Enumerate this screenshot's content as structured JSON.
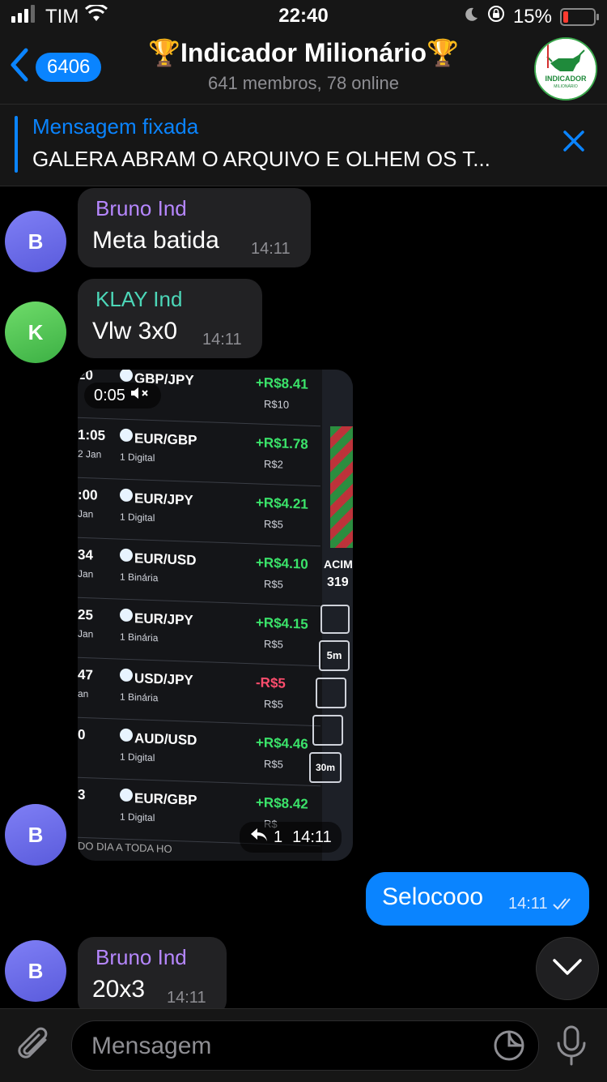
{
  "status_bar": {
    "carrier": "TIM",
    "time": "22:40",
    "battery": "15%"
  },
  "header": {
    "back_count": "6406",
    "title": "🏆Indicador Milionário🏆",
    "subtitle": "641 membros, 78 online",
    "avatar_logo_text": "INDICADOR MILIONÁRIO"
  },
  "pinned": {
    "title": "Mensagem fixada",
    "text": "GALERA ABRAM O ARQUIVO E OLHEM OS T..."
  },
  "messages": [
    {
      "sender": "Bruno Ind",
      "initial": "B",
      "text": "Meta batida",
      "time": "14:11"
    },
    {
      "sender": "KLAY Ind",
      "initial": "K",
      "text": "Vlw 3x0",
      "time": "14:11"
    },
    {
      "initial": "B",
      "video_duration": "0:05",
      "reply_count": "1",
      "time": "14:11"
    },
    {
      "sender": "Bruno Ind",
      "initial": "B",
      "text": "20x3",
      "time": "14:11"
    }
  ],
  "outgoing": {
    "text": "Selocooo",
    "time": "14:11"
  },
  "video_screen": {
    "rows": [
      {
        "clock": "20",
        "day": "",
        "pair": "GBP/JPY",
        "type": "",
        "gain": "+R$8.41",
        "stake": "R$10",
        "neg": false
      },
      {
        "clock": "1:05",
        "day": "2 Jan",
        "pair": "EUR/GBP",
        "type": "1 Digital",
        "gain": "+R$1.78",
        "stake": "R$2",
        "neg": false
      },
      {
        "clock": ":00",
        "day": "Jan",
        "pair": "EUR/JPY",
        "type": "1 Digital",
        "gain": "+R$4.21",
        "stake": "R$5",
        "neg": false
      },
      {
        "clock": "34",
        "day": "Jan",
        "pair": "EUR/USD",
        "type": "1 Binária",
        "gain": "+R$4.10",
        "stake": "R$5",
        "neg": false
      },
      {
        "clock": "25",
        "day": "Jan",
        "pair": "EUR/JPY",
        "type": "1 Binária",
        "gain": "+R$4.15",
        "stake": "R$5",
        "neg": false
      },
      {
        "clock": "47",
        "day": "an",
        "pair": "USD/JPY",
        "type": "1 Binária",
        "gain": "-R$5",
        "stake": "R$5",
        "neg": true
      },
      {
        "clock": "0",
        "day": "",
        "pair": "AUD/USD",
        "type": "1 Digital",
        "gain": "+R$4.46",
        "stake": "R$5",
        "neg": false
      },
      {
        "clock": "3",
        "day": "",
        "pair": "EUR/GBP",
        "type": "1 Digital",
        "gain": "+R$8.42",
        "stake": "R$",
        "neg": false
      }
    ],
    "side_label": "ACIM",
    "side_value": "319",
    "side_buttons": [
      "5m",
      "30m"
    ],
    "footer": "DO DIA A TODA HO"
  },
  "composer": {
    "placeholder": "Mensagem"
  },
  "colors": {
    "accent": "#0a84ff",
    "bruno_name": "#b687ff",
    "klay_name": "#4cd7b8"
  }
}
